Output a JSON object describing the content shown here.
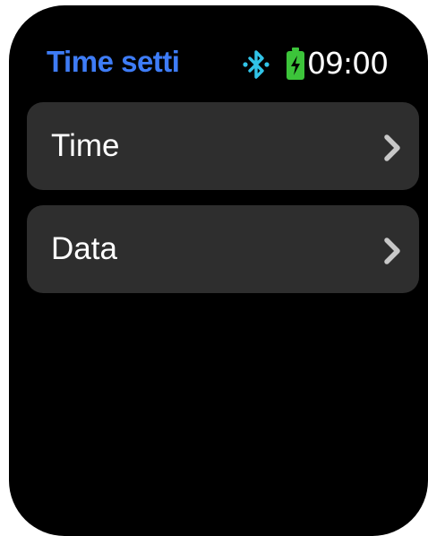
{
  "header": {
    "title": "Time setti",
    "time": "09:00",
    "status_icons": [
      "bluetooth-icon",
      "battery-charging-icon"
    ]
  },
  "colors": {
    "title": "#3e7cf6",
    "bluetooth": "#31c4e8",
    "battery": "#3cc43a",
    "item_background": "#2e2e2e",
    "chevron": "#c8c8c8",
    "screen": "#000000"
  },
  "menu": {
    "items": [
      {
        "label": "Time",
        "icon": "chevron-right-icon"
      },
      {
        "label": "Data",
        "icon": "chevron-right-icon"
      }
    ]
  }
}
